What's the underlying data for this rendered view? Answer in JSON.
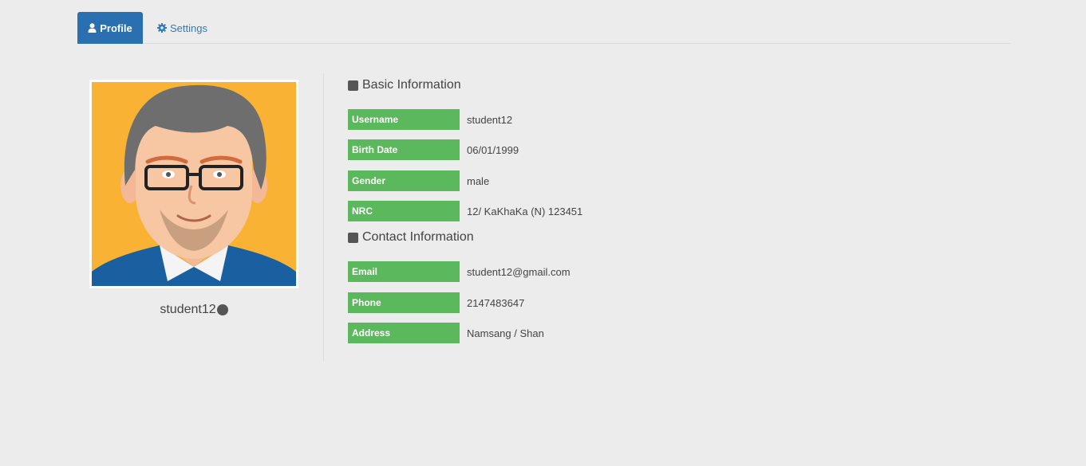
{
  "tabs": {
    "profile_label": "Profile",
    "settings_label": "Settings"
  },
  "profile": {
    "username": "student12"
  },
  "basic_info": {
    "title": "Basic Information",
    "rows": [
      {
        "label": "Username",
        "value": "student12"
      },
      {
        "label": "Birth Date",
        "value": "06/01/1999"
      },
      {
        "label": "Gender",
        "value": "male"
      },
      {
        "label": "NRC",
        "value": "12/ KaKhaKa (N) 123451"
      }
    ]
  },
  "contact_info": {
    "title": "Contact Information",
    "rows": [
      {
        "label": "Email",
        "value": "student12@gmail.com"
      },
      {
        "label": "Phone",
        "value": "2147483647"
      },
      {
        "label": "Address",
        "value": "Namsang / Shan"
      }
    ]
  },
  "colors": {
    "tab_active": "#2a6fb0",
    "link": "#337ab7",
    "label_bg": "#5cb85c",
    "page_bg": "#ececec"
  },
  "icons": {
    "profile_tab": "user-icon",
    "settings_tab": "gear-icon",
    "status": "status-dot-icon",
    "section": "square-icon"
  }
}
